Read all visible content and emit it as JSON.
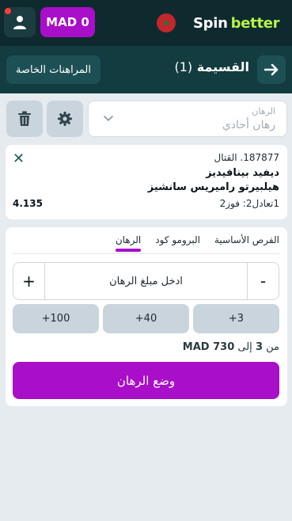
{
  "header": {
    "logo_spin": "Spin",
    "logo_better": "better",
    "balance": "MAD 0",
    "flag_icon": "morocco-flag-icon",
    "user_icon": "user-icon"
  },
  "slip": {
    "title": "القسيمة",
    "count": "(1)",
    "private_bets_label": "المراهنات الخاصة",
    "back_icon": "arrow-right-icon"
  },
  "controls": {
    "bet_type_label": "الرهان",
    "bet_type_value": "رهان أحادي",
    "settings_icon": "gear-icon",
    "delete_icon": "trash-icon"
  },
  "event": {
    "league": "187877. القتال",
    "team1": "ديفيد بينافيديز",
    "team2": "هيلبيرتو راميريس سانشيز",
    "market": "1تعادل2: فوز2",
    "odds": "4.135",
    "close_label": "✕"
  },
  "stake_panel": {
    "tabs": [
      {
        "label": "الرهان",
        "active": true
      },
      {
        "label": "البرومو كود",
        "active": false
      },
      {
        "label": "الفرص الأساسية",
        "active": false
      }
    ],
    "stake_placeholder": "ادخل مبلغ الرهان",
    "minus_label": "-",
    "plus_label": "+",
    "quick_amounts": [
      "+3",
      "+40",
      "+100"
    ],
    "range_prefix": "من",
    "range_min": "3",
    "range_mid": "إلى",
    "range_max": "MAD 730",
    "place_bet_label": "وضع الرهان"
  },
  "colors": {
    "accent": "#a90ec8",
    "header_bg": "#0e2a2e",
    "slip_bg": "#123c40",
    "page_bg": "#e6ebf0"
  }
}
